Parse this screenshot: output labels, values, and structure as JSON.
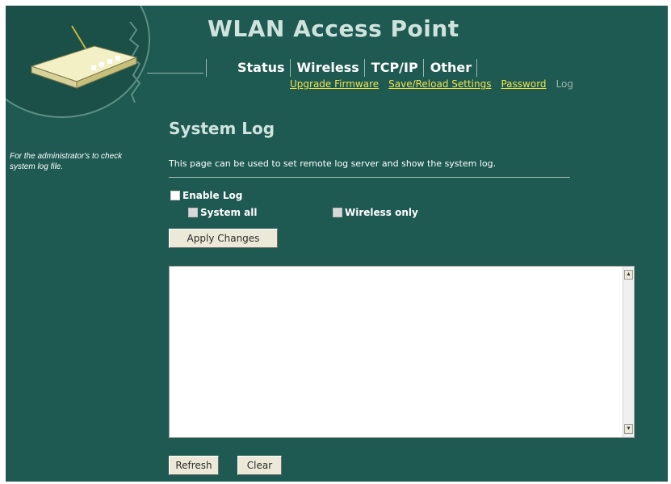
{
  "header": {
    "title": "WLAN Access Point"
  },
  "tabs": [
    "Status",
    "Wireless",
    "TCP/IP",
    "Other"
  ],
  "subnav": [
    {
      "label": "Upgrade Firmware",
      "current": false
    },
    {
      "label": "Save/Reload Settings",
      "current": false
    },
    {
      "label": "Password",
      "current": false
    },
    {
      "label": "Log",
      "current": true
    }
  ],
  "sidebar": {
    "description": "For the administrator's to check system log file."
  },
  "main": {
    "title": "System Log",
    "description": "This page can be used to set remote log server and show the system log.",
    "enable_log": "Enable Log",
    "system_all": "System all",
    "wireless_only": "Wireless only",
    "apply_button": "Apply Changes",
    "log_text": "",
    "refresh_button": "Refresh",
    "clear_button": "Clear"
  },
  "icons": {
    "logo": "router-icon"
  },
  "colors": {
    "background": "#1e5a52",
    "link": "#f1e24a",
    "title": "#cfe3dd"
  }
}
